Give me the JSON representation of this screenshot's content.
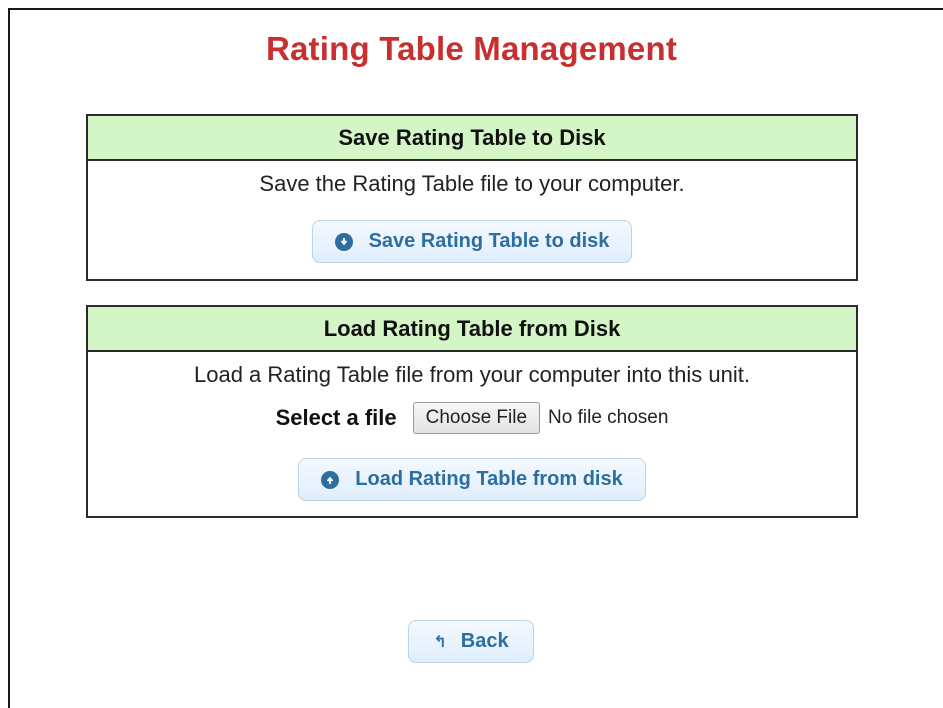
{
  "page": {
    "title": "Rating Table Management"
  },
  "save_panel": {
    "header": "Save Rating Table to Disk",
    "description": "Save the Rating Table file to your computer.",
    "button_label": "Save Rating Table to disk",
    "button_icon": "download-circle-icon"
  },
  "load_panel": {
    "header": "Load Rating Table from Disk",
    "description": "Load a Rating Table file from your computer into this unit.",
    "file_label": "Select a file",
    "file_button": "Choose File",
    "file_status": "No file chosen",
    "button_label": "Load Rating Table from disk",
    "button_icon": "upload-circle-icon"
  },
  "back": {
    "label": "Back",
    "icon": "return-arrow-icon"
  },
  "colors": {
    "title": "#c8302f",
    "panel_header_bg": "#d4f5c6",
    "button_text": "#2e6e9e"
  }
}
